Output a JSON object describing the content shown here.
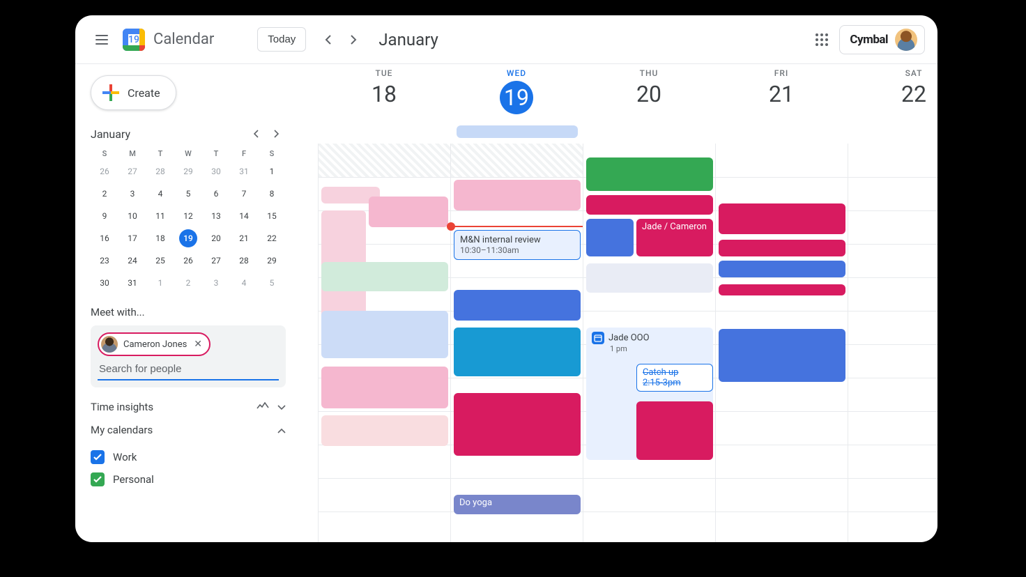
{
  "header": {
    "appTitle": "Calendar",
    "logoDay": "19",
    "todayLabel": "Today",
    "monthLabel": "January",
    "brand": "Cymbal"
  },
  "sidebar": {
    "createLabel": "Create",
    "miniMonth": "January",
    "dow": [
      "S",
      "M",
      "T",
      "W",
      "T",
      "F",
      "S"
    ],
    "weeks": [
      [
        "26",
        "27",
        "28",
        "29",
        "30",
        "31",
        "1"
      ],
      [
        "2",
        "3",
        "4",
        "5",
        "6",
        "7",
        "8"
      ],
      [
        "9",
        "10",
        "11",
        "12",
        "13",
        "14",
        "15"
      ],
      [
        "16",
        "17",
        "18",
        "19",
        "20",
        "21",
        "22"
      ],
      [
        "23",
        "24",
        "25",
        "26",
        "27",
        "28",
        "29"
      ],
      [
        "30",
        "31",
        "1",
        "2",
        "3",
        "4",
        "5"
      ]
    ],
    "todayCell": "19",
    "otherMonthDays": [
      "26",
      "27",
      "28",
      "29",
      "30",
      "31"
    ],
    "otherMonthDaysEnd": [
      "1",
      "2",
      "3",
      "4",
      "5"
    ],
    "meetWithLabel": "Meet with...",
    "chipName": "Cameron Jones",
    "searchPlaceholder": "Search for people",
    "timeInsightsLabel": "Time insights",
    "myCalendarsLabel": "My calendars",
    "calendars": [
      {
        "label": "Work",
        "color": "blue"
      },
      {
        "label": "Personal",
        "color": "green"
      }
    ]
  },
  "days": [
    {
      "dow": "TUE",
      "num": "18"
    },
    {
      "dow": "WED",
      "num": "19",
      "today": true
    },
    {
      "dow": "THU",
      "num": "20"
    },
    {
      "dow": "FRI",
      "num": "21"
    },
    {
      "dow": "SAT",
      "num": "22"
    }
  ],
  "events": {
    "allday_wed": "",
    "wed_review_title": "M&N internal review",
    "wed_review_time": "10:30–11:30am",
    "thu_jade_title": "Jade / Cameron",
    "thu_ooo_title": "Jade OOO",
    "thu_ooo_time": "1 pm",
    "thu_catchup_title": "Catch up",
    "thu_catchup_time": "2:15-3pm",
    "wed_yoga": "Do yoga"
  }
}
